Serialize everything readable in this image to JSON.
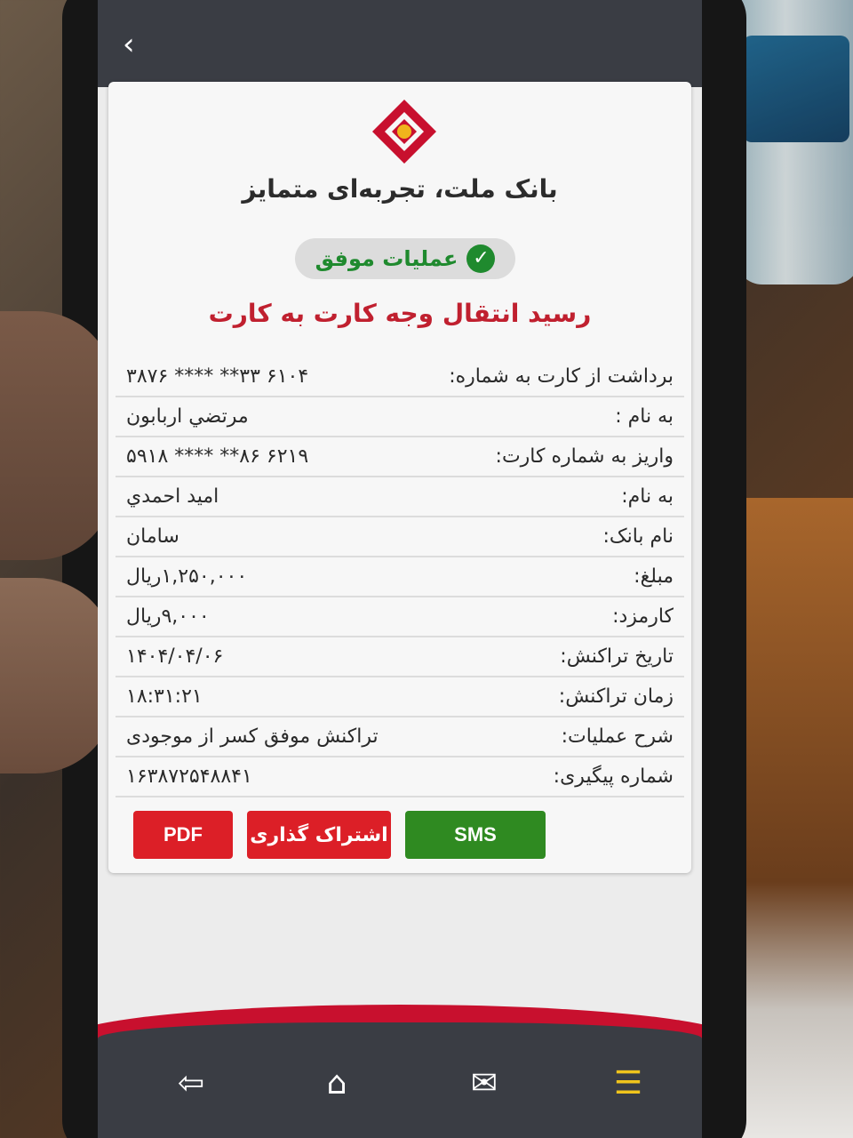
{
  "bank": {
    "tagline": "بانک ملت، تجربه‌ای متمایز",
    "logo_icon": "bank-mellat-logo-icon",
    "brand_color": "#c8102e"
  },
  "status": {
    "text": "عملیات موفق",
    "icon": "check-circle-icon",
    "color": "#1f8a2e"
  },
  "receipt_title": "رسید انتقال وجه کارت به کارت",
  "rows": [
    {
      "label": "برداشت از کارت به شماره:",
      "value": "۶۱۰۴ ۳۳** **** ۳۸۷۶"
    },
    {
      "label": "به نام :",
      "value": "مرتضي اربابون"
    },
    {
      "label": "واریز به شماره کارت:",
      "value": "۶۲۱۹ ۸۶** **** ۵۹۱۸"
    },
    {
      "label": "به نام:",
      "value": "امید احمدي"
    },
    {
      "label": "نام بانک:",
      "value": "سامان"
    },
    {
      "label": "مبلغ:",
      "value": "۱,۲۵۰,۰۰۰ریال"
    },
    {
      "label": "کارمزد:",
      "value": "۹,۰۰۰ریال"
    },
    {
      "label": "تاریخ تراکنش:",
      "value": "۱۴۰۴/۰۴/۰۶"
    },
    {
      "label": "زمان تراکنش:",
      "value": "۱۸:۳۱:۲۱"
    },
    {
      "label": "شرح عملیات:",
      "value": "تراکنش موفق کسر از موجودی"
    },
    {
      "label": "شماره پیگیری:",
      "value": "۱۶۳۸۷۲۵۴۸۸۴۱"
    }
  ],
  "actions": {
    "pdf_label": "PDF",
    "share_label": "اشتراک گذاری",
    "sms_label": "SMS"
  },
  "nav": {
    "back_icon": "chevron-left-icon",
    "items": [
      "exit-icon",
      "home-icon",
      "mail-icon",
      "menu-icon"
    ]
  }
}
